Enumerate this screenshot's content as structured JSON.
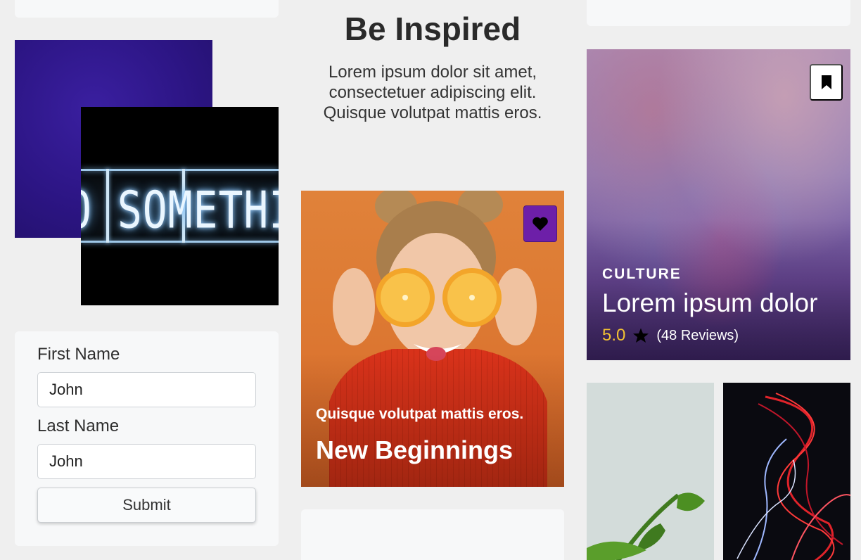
{
  "left_column": {
    "neon_sign_text": "O SOMETHING GRE",
    "form": {
      "first_name_label": "First Name",
      "first_name_value": "John",
      "last_name_label": "Last Name",
      "last_name_value": "John",
      "submit_label": "Submit"
    }
  },
  "middle_column": {
    "title": "Be Inspired",
    "intro_text": "Lorem ipsum dolor sit amet, consectetuer adipiscing elit. Quisque volutpat mattis eros.",
    "feature_card": {
      "eyebrow": "Quisque volutpat mattis eros.",
      "headline": "New Beginnings",
      "favorite_icon": "heart-icon",
      "accent_color": "#6d1fa8"
    }
  },
  "right_column": {
    "culture_card": {
      "category": "CULTURE",
      "title": "Lorem ipsum dolor",
      "rating": "5.0",
      "reviews": "(48 Reviews)",
      "bookmark_icon": "bookmark-icon",
      "rating_color": "#f2c233"
    }
  }
}
